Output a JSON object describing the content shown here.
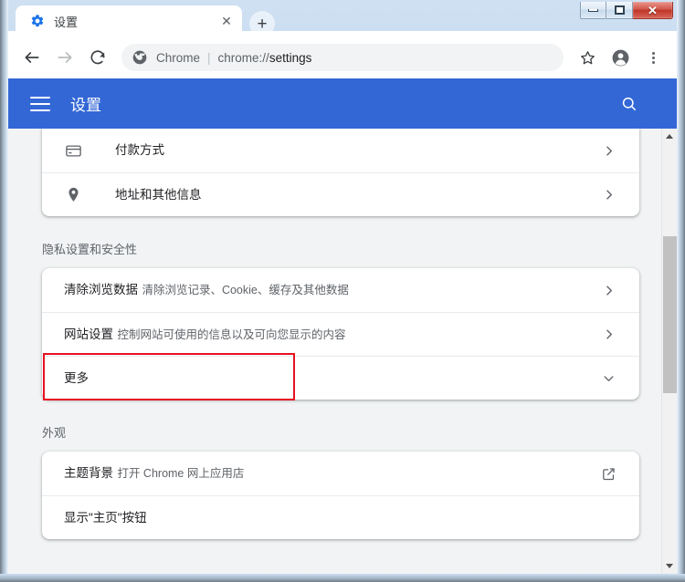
{
  "window": {
    "controls": {
      "minimize": "minimize-button",
      "maximize": "restore-button",
      "close_glyph": "✕"
    }
  },
  "tabstrip": {
    "tab": {
      "favicon": "gear-icon",
      "title": "设置",
      "close_glyph": "✕"
    },
    "new_tab_glyph": "+"
  },
  "toolbar": {
    "back": "back-arrow-icon",
    "forward": "forward-arrow-icon",
    "reload": "reload-icon",
    "omnibox": {
      "icon": "chrome-logo-icon",
      "scheme_label": "Chrome",
      "separator": "|",
      "url_prefix": "chrome://",
      "url_emphasis": "settings",
      "url_full": "chrome://settings"
    },
    "bookmark": "star-icon",
    "profile": "account-avatar-icon",
    "menu": "three-dot-menu-icon"
  },
  "settings_header": {
    "menu_icon": "hamburger-icon",
    "title": "设置",
    "search_icon": "search-icon",
    "background_color": "#3367d6"
  },
  "content": {
    "autofill_rows": [
      {
        "icon": "credit-card-icon",
        "title": "付款方式",
        "sub": "",
        "end": "chevron-right-icon"
      },
      {
        "icon": "location-pin-icon",
        "title": "地址和其他信息",
        "sub": "",
        "end": "chevron-right-icon"
      }
    ],
    "privacy": {
      "section_title": "隐私设置和安全性",
      "rows": [
        {
          "title": "清除浏览数据",
          "sub": "清除浏览记录、Cookie、缓存及其他数据",
          "end": "chevron-right-icon"
        },
        {
          "title": "网站设置",
          "sub": "控制网站可使用的信息以及可向您显示的内容",
          "end": "chevron-right-icon"
        },
        {
          "title": "更多",
          "sub": "",
          "end": "chevron-down-icon"
        }
      ]
    },
    "appearance": {
      "section_title": "外观",
      "rows": [
        {
          "title": "主题背景",
          "sub": "打开 Chrome 网上应用店",
          "end": "external-link-icon"
        },
        {
          "title": "显示\"主页\"按钮",
          "sub": "",
          "end": ""
        }
      ]
    }
  },
  "annotation": {
    "highlight_target": "清除浏览数据",
    "color": "#e81123"
  },
  "scrollbar": {
    "up_arrow": "scroll-up-arrow",
    "down_arrow": "scroll-down-arrow",
    "thumb": "scroll-thumb"
  }
}
